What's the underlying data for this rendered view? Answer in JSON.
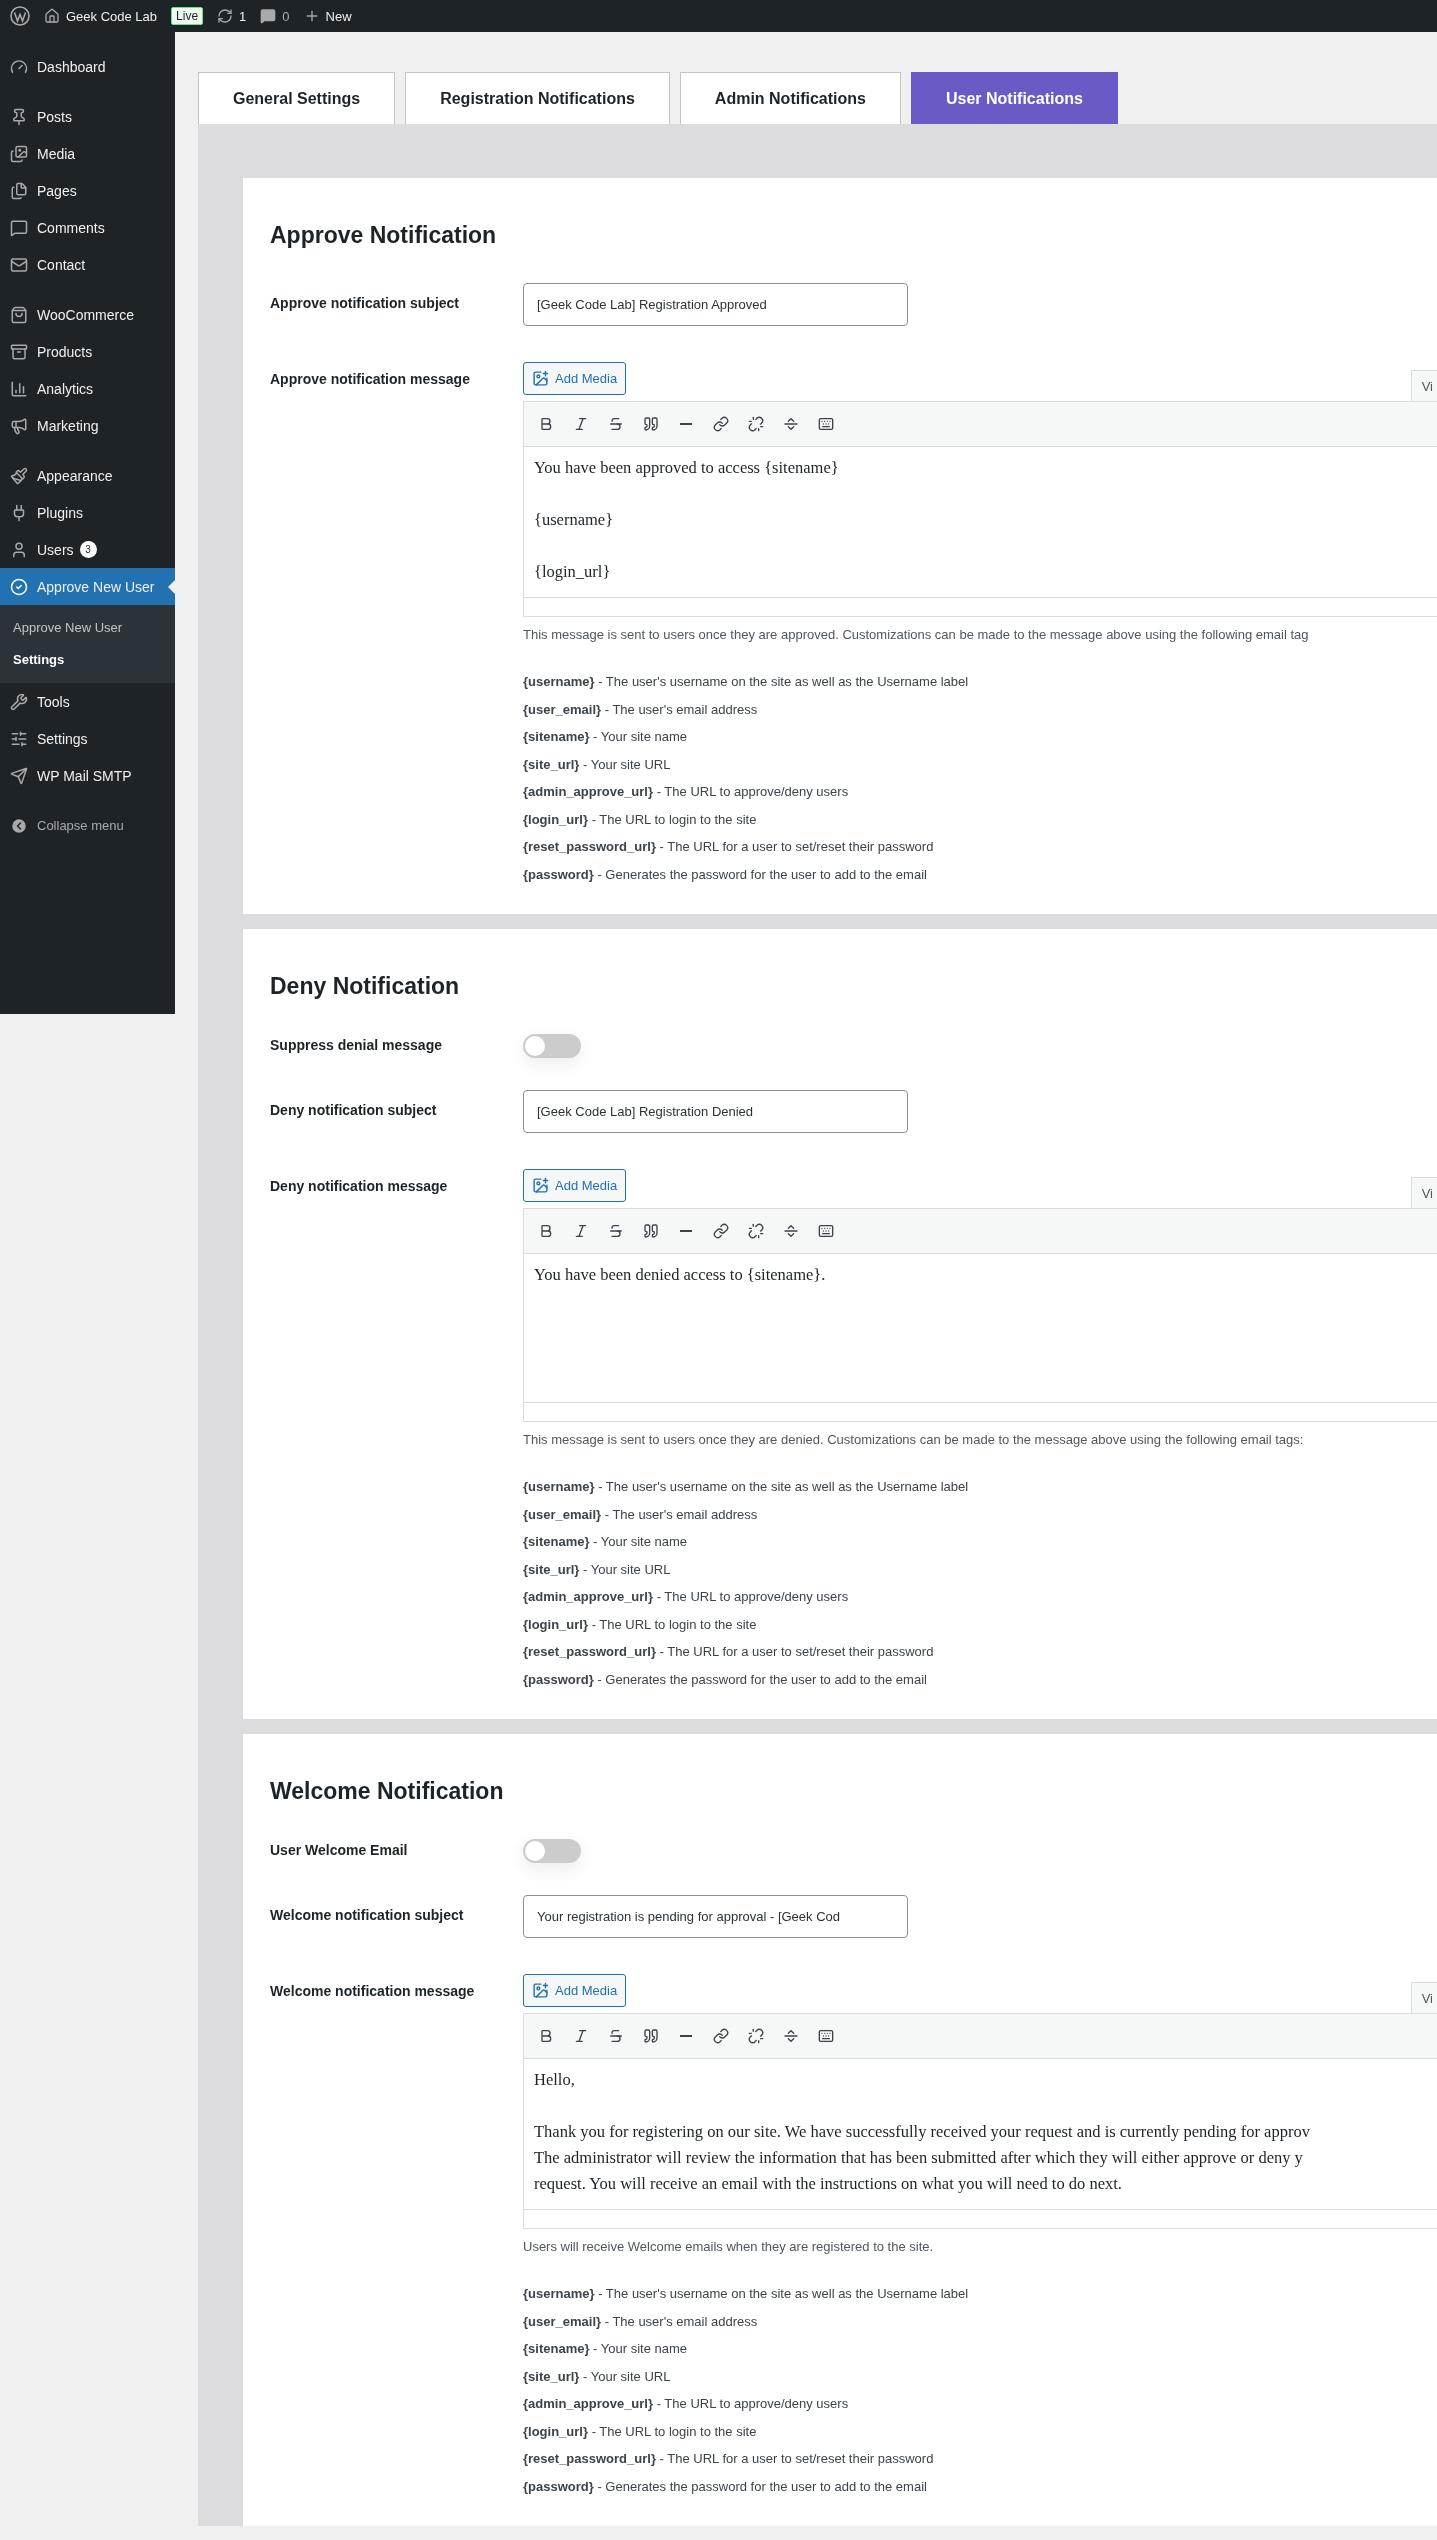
{
  "admin_bar": {
    "site_name": "Geek Code Lab",
    "live_badge": "Live",
    "updates_count": "1",
    "comments_count": "0",
    "new_label": "New"
  },
  "sidebar": {
    "groups": [
      {
        "items": [
          {
            "label": "Dashboard",
            "selected": false
          }
        ]
      },
      {
        "items": [
          {
            "label": "Posts",
            "selected": false
          },
          {
            "label": "Media",
            "selected": false
          },
          {
            "label": "Pages",
            "selected": false
          },
          {
            "label": "Comments",
            "selected": false
          },
          {
            "label": "Contact",
            "selected": false
          }
        ]
      },
      {
        "items": [
          {
            "label": "WooCommerce",
            "selected": false
          },
          {
            "label": "Products",
            "selected": false
          },
          {
            "label": "Analytics",
            "selected": false
          },
          {
            "label": "Marketing",
            "selected": false
          }
        ]
      },
      {
        "items": [
          {
            "label": "Appearance",
            "selected": false
          },
          {
            "label": "Plugins",
            "selected": false
          },
          {
            "label": "Users",
            "selected": false,
            "badge": "3"
          },
          {
            "label": "Approve New User",
            "selected": true,
            "submenu": [
              {
                "label": "Approve New User",
                "selected": false
              },
              {
                "label": "Settings",
                "selected": true
              }
            ]
          },
          {
            "label": "Tools",
            "selected": false
          },
          {
            "label": "Settings",
            "selected": false
          },
          {
            "label": "WP Mail SMTP",
            "selected": false
          }
        ]
      }
    ],
    "collapse_label": "Collapse menu"
  },
  "tabs": [
    {
      "label": "General Settings",
      "selected": false
    },
    {
      "label": "Registration Notifications",
      "selected": false
    },
    {
      "label": "Admin Notifications",
      "selected": false
    },
    {
      "label": "User Notifications",
      "selected": true
    }
  ],
  "sections": [
    {
      "title": "Approve Notification",
      "rows": [
        {
          "kind": "text",
          "label": "Approve notification subject",
          "value": "[Geek Code Lab] Registration Approved"
        },
        {
          "kind": "editor",
          "label": "Approve notification message",
          "add_media": "Add Media",
          "mode_tab": "Vi",
          "paragraphs": [
            [
              "You have been approved to access {sitename}"
            ],
            [
              "{username}"
            ],
            [
              "{login_url}"
            ]
          ]
        }
      ],
      "description": "This message is sent to users once they are approved. Customizations can be made to the message above using the following email tag",
      "tags": [
        "**{username}** - The user's username on the site as well as the Username label",
        "**{user_email}** - The user's email address",
        "**{sitename}** - Your site name",
        "**{site_url}** - Your site URL",
        "**{admin_approve_url}** - The URL to approve/deny users",
        "**{login_url}** - The URL to login to the site",
        "**{reset_password_url}** - The URL for a user to set/reset their password",
        "**{password}** - Generates the password for the user to add to the email"
      ]
    },
    {
      "title": "Deny Notification",
      "rows": [
        {
          "kind": "toggle",
          "label": "Suppress denial message",
          "on": false
        },
        {
          "kind": "text",
          "label": "Deny notification subject",
          "value": "[Geek Code Lab] Registration Denied"
        },
        {
          "kind": "editor",
          "label": "Deny notification message",
          "add_media": "Add Media",
          "mode_tab": "Vi",
          "paragraphs": [
            [
              "You have been denied access to {sitename}."
            ]
          ]
        }
      ],
      "description": "This message is sent to users once they are denied. Customizations can be made to the message above using the following email tags:",
      "tags": [
        "**{username}** - The user's username on the site as well as the Username label",
        "**{user_email}** - The user's email address",
        "**{sitename}** - Your site name",
        "**{site_url}** - Your site URL",
        "**{admin_approve_url}** - The URL to approve/deny users",
        "**{login_url}** - The URL to login to the site",
        "**{reset_password_url}** - The URL for a user to set/reset their password",
        "**{password}** - Generates the password for the user to add to the email"
      ]
    },
    {
      "title": "Welcome Notification",
      "rows": [
        {
          "kind": "toggle",
          "label": "User Welcome Email",
          "on": false
        },
        {
          "kind": "text",
          "label": "Welcome notification subject",
          "value": "Your registration is pending for approval - [Geek Cod"
        },
        {
          "kind": "editor",
          "label": "Welcome notification message",
          "add_media": "Add Media",
          "mode_tab": "Vi",
          "paragraphs": [
            [
              "Hello,"
            ],
            [
              "Thank you for registering on our site. We have successfully received your request and is currently pending for approv",
              "The administrator will review the information that has been submitted after which they will either approve or deny y",
              "request. You will receive an email with the instructions on what you will need to do next."
            ]
          ]
        }
      ],
      "description": "Users will receive Welcome emails when they are registered to the site.",
      "tags": [
        "**{username}** - The user's username on the site as well as the Username label",
        "**{user_email}** - The user's email address",
        "**{sitename}** - Your site name",
        "**{site_url}** - Your site URL",
        "**{admin_approve_url}** - The URL to approve/deny users",
        "**{login_url}** - The URL to login to the site",
        "**{reset_password_url}** - The URL for a user to set/reset their password",
        "**{password}** - Generates the password for the user to add to the email"
      ]
    }
  ]
}
